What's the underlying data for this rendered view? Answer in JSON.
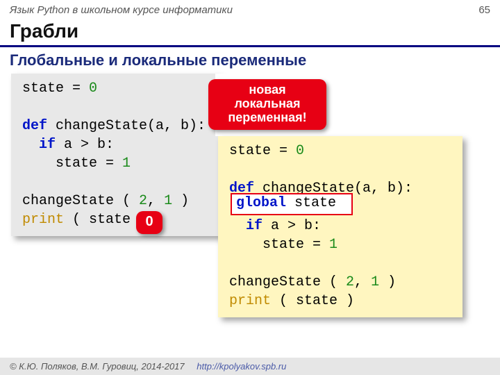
{
  "header": {
    "course": "Язык Python в школьном курсе информатики",
    "page": "65"
  },
  "title": "Грабли",
  "subtitle": "Глобальные и локальные переменные",
  "code1": {
    "l1a": "state = ",
    "l1n": "0",
    "l2a": "def",
    "l2b": " changeState(a, b):",
    "l3a": "  if",
    "l3b": " a > b:",
    "l4a": "    state = ",
    "l4n": "1",
    "l5a": "changeState ( ",
    "l5n1": "2",
    "l5m": ", ",
    "l5n2": "1",
    "l5e": " )",
    "l6a": "print",
    "l6b": " ( state )"
  },
  "callout": {
    "big_l1": "новая",
    "big_l2": "локальная",
    "big_l3": "переменная!",
    "small": "0"
  },
  "code2": {
    "l1a": "state = ",
    "l1n": "0",
    "l2a": "def",
    "l2b": " changeState(a, b):",
    "gap": " ",
    "l4a": "  if",
    "l4b": " a > b:",
    "l5a": "    state = ",
    "l5n": "1",
    "l6a": "changeState ( ",
    "l6n1": "2",
    "l6m": ", ",
    "l6n2": "1",
    "l6e": " )",
    "l7a": "print",
    "l7b": " ( state )"
  },
  "globalbox": {
    "kw": "global",
    "rest": " state"
  },
  "footer": {
    "copy": "© К.Ю. Поляков, В.М. Гуровиц, 2014-2017",
    "url": "http://kpolyakov.spb.ru"
  }
}
